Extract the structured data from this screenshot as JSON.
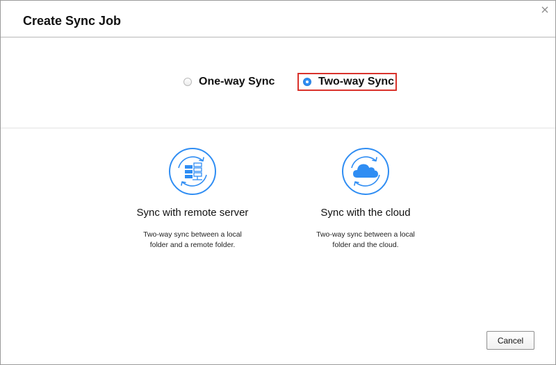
{
  "dialog": {
    "title": "Create Sync Job",
    "close_icon": "close-icon"
  },
  "sync_mode": {
    "options": [
      {
        "label": "One-way Sync",
        "selected": false
      },
      {
        "label": "Two-way Sync",
        "selected": true
      }
    ],
    "highlight_color": "#d9322b",
    "radio_color": "#2f8df3"
  },
  "targets": [
    {
      "icon": "server-sync-icon",
      "title": "Sync with remote server",
      "description": "Two-way sync between a local folder and a remote folder."
    },
    {
      "icon": "cloud-sync-icon",
      "title": "Sync with the cloud",
      "description": "Two-way sync between a local folder and the cloud."
    }
  ],
  "footer": {
    "cancel_label": "Cancel"
  },
  "colors": {
    "accent": "#2f8df3",
    "icon_stroke": "#2f8df3"
  }
}
